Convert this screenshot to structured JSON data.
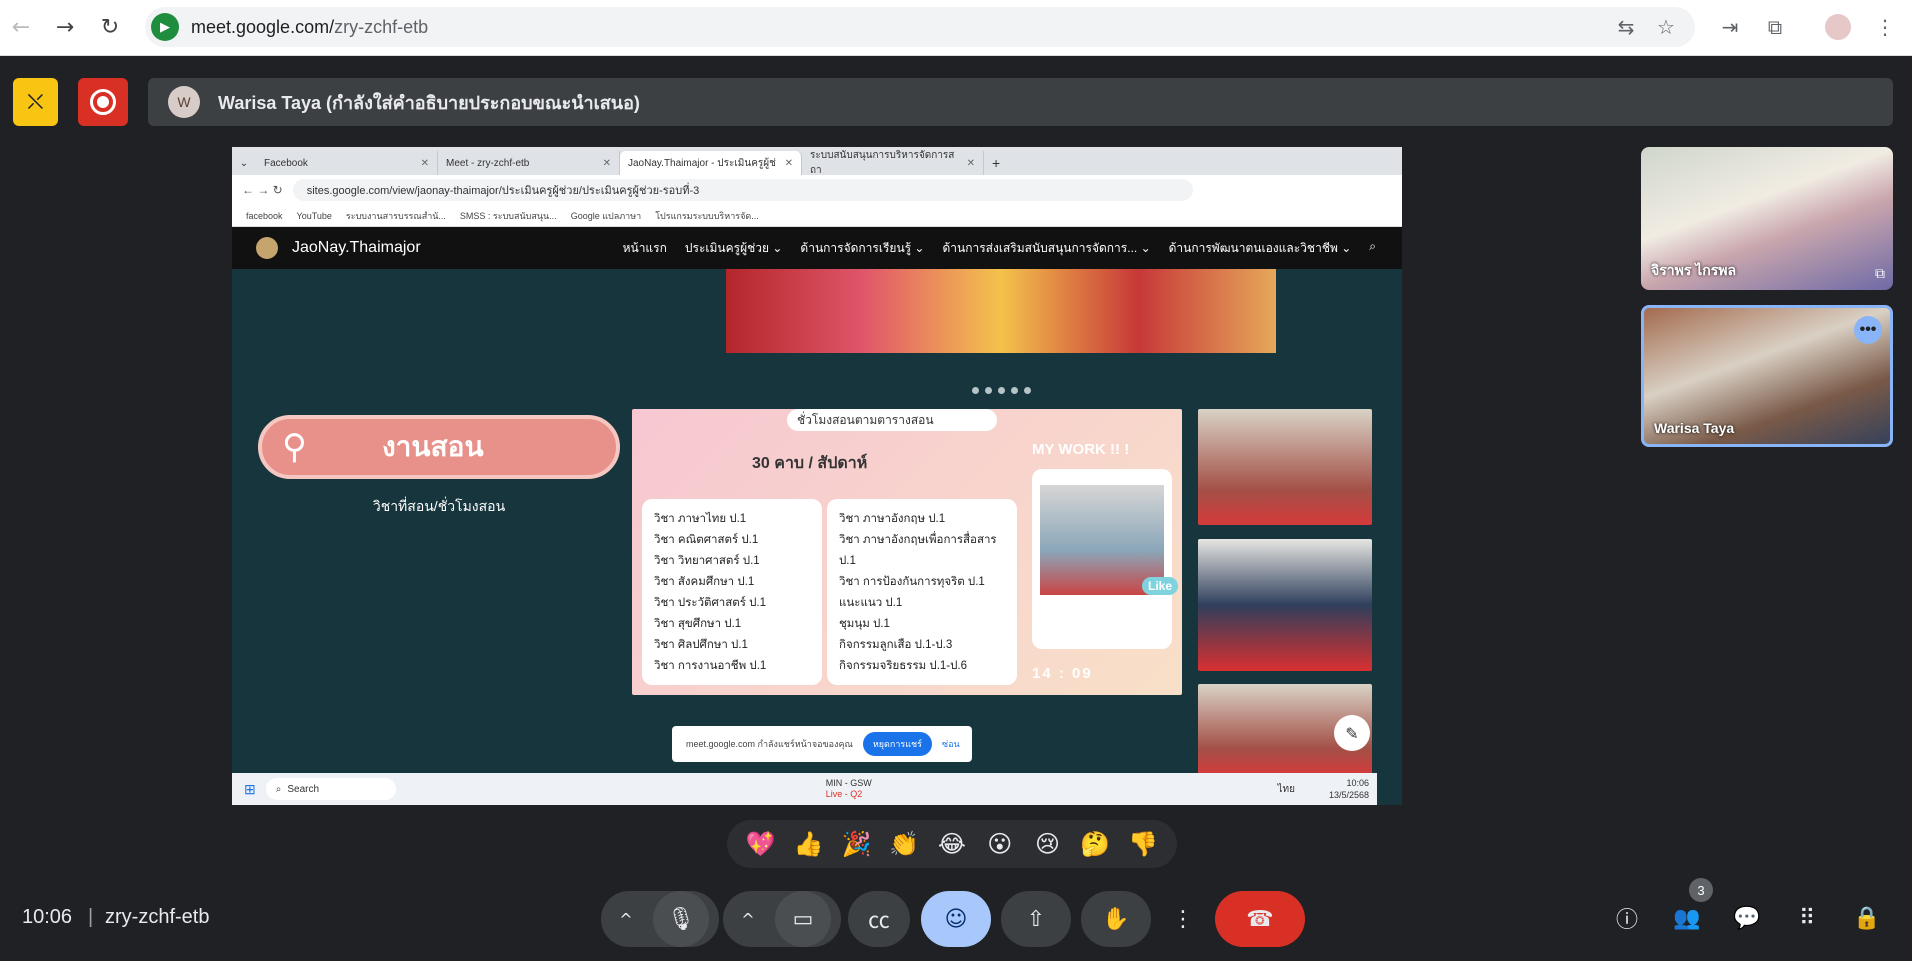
{
  "browser": {
    "url_host": "meet.google.com/",
    "url_path": "zry-zchf-etb",
    "back_icon": "arrow-left-icon",
    "forward_icon": "arrow-right-icon",
    "reload_icon": "reload-icon"
  },
  "meet_header": {
    "presenter_text": "Warisa Taya (กำลังใส่คำอธิบายประกอบขณะนำเสนอ)",
    "presenter_initial": "W"
  },
  "shared_screen": {
    "tabs": [
      {
        "label": "Facebook"
      },
      {
        "label": "Meet - zry-zchf-etb"
      },
      {
        "label": "JaoNay.Thaimajor - ประเมินครูผู้ช่"
      },
      {
        "label": "ระบบสนับสนุนการบริหารจัดการสถา"
      }
    ],
    "address": "sites.google.com/view/jaonay-thaimajor/ประเมินครูผู้ช่วย/ประเมินครูผู้ช่วย-รอบที่-3",
    "bookmarks": [
      "facebook",
      "YouTube",
      "ระบบงานสารบรรณสำนั...",
      "SMSS : ระบบสนับสนุน...",
      "Google แปลภาษา",
      "โปรแกรมระบบบริหารจัด..."
    ],
    "site_title": "JaoNay.Thaimajor",
    "menu": [
      "หน้าแรก",
      "ประเมินครูผู้ช่วย ⌄",
      "ด้านการจัดการเรียนรู้ ⌄",
      "ด้านการส่งเสริมสนับสนุนการจัดการ... ⌄",
      "ด้านการพัฒนาตนเองและวิชาชีพ ⌄"
    ],
    "search_pill_label": "งานสอน",
    "sub_label": "วิชาที่สอน/ชั่วโมงสอน",
    "schedule": {
      "search_text": "ชั่วโมงสอนตามตารางสอน",
      "header": "30 คาบ / สัปดาห์",
      "mywork": "MY WORK !! !",
      "left": [
        "วิชา ภาษาไทย ป.1",
        "วิชา คณิตศาสตร์ ป.1",
        "วิชา วิทยาศาสตร์ ป.1",
        "วิชา สังคมศึกษา ป.1",
        "วิชา ประวัติศาสตร์ ป.1",
        "วิชา สุขศึกษา ป.1",
        "วิชา ศิลปศึกษา ป.1",
        "วิชา การงานอาชีพ ป.1"
      ],
      "right": [
        "วิชา ภาษาอังกฤษ ป.1",
        "วิชา ภาษาอังกฤษเพื่อการสื่อสาร ป.1",
        "วิชา การป้องกันการทุจริต ป.1",
        "แนะแนว ป.1",
        "ชุมนุม ป.1",
        "กิจกรรมลูกเสือ ป.1-ป.3",
        "กิจกรรมจริยธรรม ป.1-ป.6"
      ],
      "like_label": "Like",
      "time": "14 : 09"
    },
    "notification": {
      "text": "meet.google.com กำลังแชร์หน้าจอของคุณ",
      "stop": "หยุดการแชร์",
      "hide": "ซ่อน"
    },
    "taskbar": {
      "search": "Search",
      "weather_line1": "MIN - GSW",
      "weather_line2": "Live - Q2",
      "lang": "ไทย",
      "time": "10:06",
      "date": "13/5/2568"
    }
  },
  "participants": [
    {
      "name": "จิราพร ไกรพล"
    },
    {
      "name": "Warisa Taya"
    }
  ],
  "reactions": [
    "💖",
    "👍",
    "🎉",
    "👏",
    "😂",
    "😮",
    "😢",
    "🤔",
    "👎"
  ],
  "bottom_bar": {
    "clock": "10:06",
    "separator": "|",
    "meet_code": "zry-zchf-etb",
    "people_count": "3"
  },
  "colors": {
    "meet_bg": "#202124",
    "leave_red": "#d93025",
    "accent_blue": "#a8c7fa",
    "camera_off_yellow": "#f9c513"
  }
}
